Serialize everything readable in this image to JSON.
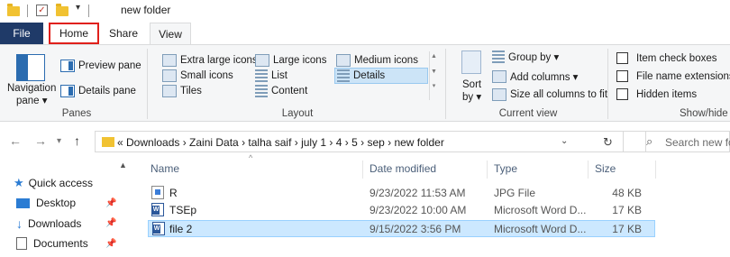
{
  "window": {
    "title": "new folder"
  },
  "tabs": {
    "file": "File",
    "home": "Home",
    "share": "Share",
    "view": "View"
  },
  "ribbon": {
    "panes": {
      "navigation_pane_line1": "Navigation",
      "navigation_pane_line2": "pane ▾",
      "preview_pane": "Preview pane",
      "details_pane": "Details pane",
      "group_label": "Panes"
    },
    "layout": {
      "extra_large_icons": "Extra large icons",
      "large_icons": "Large icons",
      "medium_icons": "Medium icons",
      "small_icons": "Small icons",
      "list": "List",
      "details": "Details",
      "tiles": "Tiles",
      "content": "Content",
      "group_label": "Layout",
      "selected": "Details"
    },
    "current_view": {
      "sort_by_line1": "Sort",
      "sort_by_line2": "by ▾",
      "group_by": "Group by ▾",
      "add_columns": "Add columns ▾",
      "size_all_columns": "Size all columns to fit",
      "group_label": "Current view"
    },
    "show_hide": {
      "item_check_boxes": "Item check boxes",
      "file_name_extensions": "File name extensions",
      "hidden_items": "Hidden items",
      "group_label": "Show/hide"
    }
  },
  "address": {
    "breadcrumb": "«  Downloads  ›  Zaini Data  ›  talha saif  ›  july 1  ›  4  ›  5  ›  sep  ›  new folder",
    "search_placeholder": "Search new fo"
  },
  "nav_pane": {
    "items": [
      {
        "label": "Quick access"
      },
      {
        "label": "Desktop"
      },
      {
        "label": "Downloads"
      },
      {
        "label": "Documents"
      }
    ]
  },
  "file_list": {
    "columns": {
      "name": "Name",
      "date_modified": "Date modified",
      "type": "Type",
      "size": "Size"
    },
    "rows": [
      {
        "name": "R",
        "date": "9/23/2022 11:53 AM",
        "type": "JPG File",
        "size": "48 KB",
        "icon": "image-file-icon"
      },
      {
        "name": "TSEp",
        "date": "9/23/2022 10:00 AM",
        "type": "Microsoft Word D...",
        "size": "17 KB",
        "icon": "word-file-icon"
      },
      {
        "name": "file 2",
        "date": "9/15/2022 3:56 PM",
        "type": "Microsoft Word D...",
        "size": "17 KB",
        "icon": "word-file-icon",
        "selected": true
      }
    ]
  },
  "colors": {
    "file_tab": "#1f3a68",
    "home_highlight": "#e0201b",
    "selection": "#cce8ff",
    "details_selected": "#cce4f7"
  }
}
